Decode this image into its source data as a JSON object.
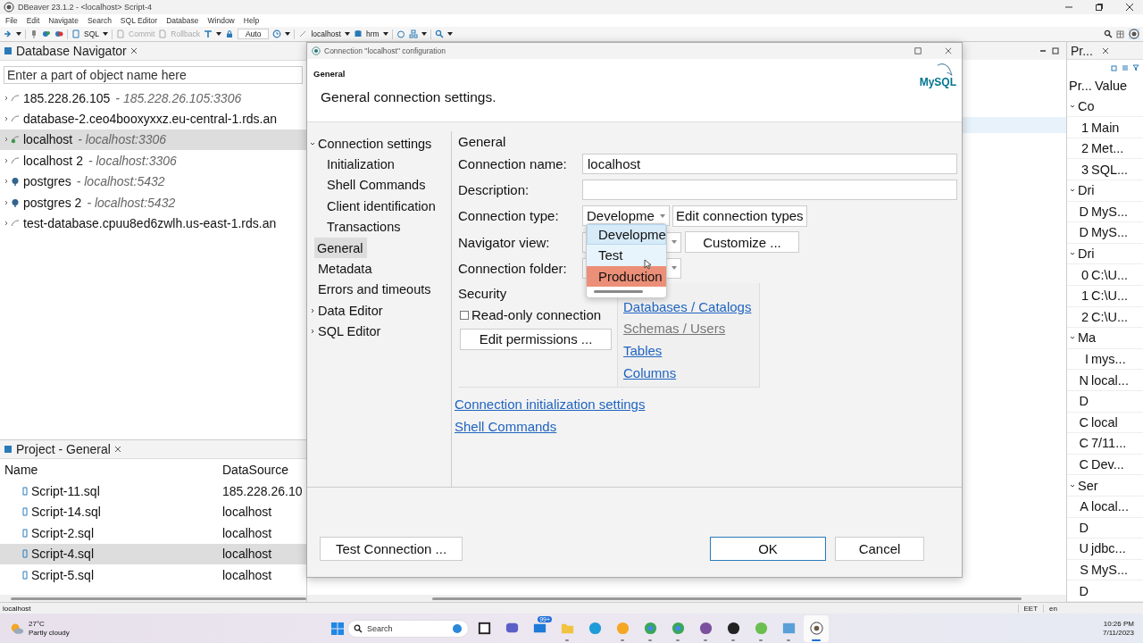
{
  "app_window": {
    "title": "DBeaver 23.1.2 - <localhost> Script-4"
  },
  "menu": [
    "File",
    "Edit",
    "Navigate",
    "Search",
    "SQL Editor",
    "Database",
    "Window",
    "Help"
  ],
  "toolbar": {
    "sql": {
      "label": "SQL"
    },
    "commit": {
      "label": "Commit",
      "disabled": true
    },
    "rollback": {
      "label": "Rollback",
      "disabled": true
    },
    "mode": "Auto",
    "datasource": "localhost",
    "schema": "hrm"
  },
  "navigator": {
    "title": "Database Navigator",
    "search": {
      "placeholder": "Enter a part of object name here"
    },
    "items": [
      {
        "name": "185.228.26.105",
        "detail": "- 185.228.26.105:3306",
        "kind": "mysql",
        "connected": false,
        "selected": false
      },
      {
        "name": "database-2.ceo4booxyxxz.eu-central-1.rds.an",
        "kind": "mysql",
        "connected": false,
        "selected": false
      },
      {
        "name": "localhost",
        "detail": "- localhost:3306",
        "kind": "mysql",
        "connected": true,
        "selected": true
      },
      {
        "name": "localhost 2",
        "detail": "- localhost:3306",
        "kind": "mysql",
        "connected": false,
        "selected": false
      },
      {
        "name": "postgres",
        "detail": "- localhost:5432",
        "kind": "postgres",
        "connected": false,
        "selected": false
      },
      {
        "name": "postgres 2",
        "detail": "- localhost:5432",
        "kind": "postgres",
        "connected": false,
        "selected": false
      },
      {
        "name": "test-database.cpuu8ed6zwlh.us-east-1.rds.an",
        "kind": "mysql",
        "connected": false,
        "selected": false
      }
    ]
  },
  "project": {
    "title": "Project - General",
    "columns": [
      "Name",
      "DataSource"
    ],
    "rows": [
      {
        "name": "Script-11.sql",
        "datasource": "185.228.26.10",
        "selected": false
      },
      {
        "name": "Script-14.sql",
        "datasource": "localhost",
        "selected": false
      },
      {
        "name": "Script-2.sql",
        "datasource": "localhost",
        "selected": false
      },
      {
        "name": "Script-4.sql",
        "datasource": "localhost",
        "selected": true
      },
      {
        "name": "Script-5.sql",
        "datasource": "localhost",
        "selected": false
      }
    ]
  },
  "properties": {
    "title": "Pr...",
    "columns": [
      "Pr...",
      "Value"
    ],
    "rows": [
      {
        "kind": "group",
        "label": "Co",
        "expanded": true
      },
      {
        "kind": "row",
        "key": "1",
        "value": "Main"
      },
      {
        "kind": "row",
        "key": "2",
        "value": "Met..."
      },
      {
        "kind": "row",
        "key": "3",
        "value": "SQL..."
      },
      {
        "kind": "group",
        "label": "Dri",
        "expanded": true
      },
      {
        "kind": "row",
        "key": "D",
        "value": "MyS..."
      },
      {
        "kind": "row",
        "key": "D",
        "value": "MyS..."
      },
      {
        "kind": "group",
        "label": "Dri",
        "expanded": true
      },
      {
        "kind": "row",
        "key": "0",
        "value": "C:\\U..."
      },
      {
        "kind": "row",
        "key": "1",
        "value": "C:\\U..."
      },
      {
        "kind": "row",
        "key": "2",
        "value": "C:\\U..."
      },
      {
        "kind": "group",
        "label": "Ma",
        "expanded": true
      },
      {
        "kind": "row",
        "key": "I",
        "value": "mys..."
      },
      {
        "kind": "row",
        "key": "N",
        "value": "local..."
      },
      {
        "kind": "row",
        "key": "D"
      },
      {
        "kind": "row",
        "key": "C",
        "value": "local"
      },
      {
        "kind": "row",
        "key": "C",
        "value": "7/11..."
      },
      {
        "kind": "row",
        "key": "C",
        "value": "Dev..."
      },
      {
        "kind": "group",
        "label": "Ser",
        "expanded": true
      },
      {
        "kind": "row",
        "key": "A",
        "value": "local..."
      },
      {
        "kind": "row",
        "key": "D"
      },
      {
        "kind": "row",
        "key": "U",
        "value": "jdbc..."
      },
      {
        "kind": "row",
        "key": "S",
        "value": "MyS..."
      },
      {
        "kind": "row",
        "key": "D"
      }
    ]
  },
  "dialog": {
    "title": "Connection \"localhost\" configuration",
    "page_title": "General",
    "description": "General connection settings.",
    "logo": "MySQL",
    "tree": [
      {
        "label": "Connection settings",
        "expanded": true,
        "selected": false,
        "children": [
          {
            "label": "Initialization",
            "selected": false
          },
          {
            "label": "Shell Commands",
            "selected": false
          },
          {
            "label": "Client identification",
            "selected": false
          },
          {
            "label": "Transactions",
            "selected": false
          }
        ]
      },
      {
        "label": "General",
        "selected": true
      },
      {
        "label": "Metadata",
        "selected": false
      },
      {
        "label": "Errors and timeouts",
        "selected": false
      },
      {
        "label": "Data Editor",
        "expanded": false,
        "selected": false
      },
      {
        "label": "SQL Editor",
        "expanded": false,
        "selected": false
      }
    ],
    "section": "General",
    "fields": [
      {
        "label": "Connection name:",
        "kind": "text",
        "value": "localhost"
      },
      {
        "label": "Description:",
        "kind": "text"
      },
      {
        "label": "Connection type:",
        "kind": "combo",
        "value": "Developme",
        "button": "Edit connection types"
      },
      {
        "label": "Navigator view:",
        "kind": "combo",
        "button": "Customize ..."
      },
      {
        "label": "Connection folder:",
        "kind": "combo"
      }
    ],
    "popup": {
      "options": [
        {
          "label": "Developme",
          "color": "#d6eaf8",
          "selected": true
        },
        {
          "label": "Test",
          "color": "#e8f4fc",
          "selected": false
        },
        {
          "label": "Production",
          "color": "#ec8f78",
          "selected": false
        }
      ]
    },
    "security": {
      "title": "Security",
      "readonly": {
        "label": "Read-only connection",
        "checked": false
      },
      "button": "Edit permissions ..."
    },
    "filters": [
      {
        "label": "Databases / Catalogs",
        "disabled": false
      },
      {
        "label": "Schemas / Users",
        "disabled": true
      },
      {
        "label": "Tables",
        "disabled": false
      },
      {
        "label": "Columns",
        "disabled": false
      }
    ],
    "links": [
      "Connection initialization settings",
      "Shell Commands"
    ],
    "buttons": {
      "test": "Test Connection ...",
      "ok": "OK",
      "cancel": "Cancel"
    }
  },
  "status_bar": {
    "left": "localhost",
    "right": [
      "EET",
      "en"
    ]
  },
  "taskbar": {
    "weather": {
      "temp": "27°C",
      "desc": "Partly cloudy"
    },
    "search": {
      "placeholder": "Search"
    },
    "apps": [
      {
        "kind": "taskview",
        "running": false,
        "active": false
      },
      {
        "kind": "chat",
        "running": false,
        "active": false
      },
      {
        "kind": "mail",
        "badge": "99+",
        "running": false,
        "active": false
      },
      {
        "kind": "folder",
        "running": true,
        "active": false
      },
      {
        "kind": "edge",
        "running": false,
        "active": false
      },
      {
        "kind": "orange",
        "running": true,
        "active": false
      },
      {
        "kind": "chrome",
        "running": true,
        "active": false
      },
      {
        "kind": "chrome",
        "running": true,
        "active": false
      },
      {
        "kind": "viber",
        "running": true,
        "active": false
      },
      {
        "kind": "dark",
        "running": true,
        "active": false
      },
      {
        "kind": "green",
        "running": true,
        "active": false
      },
      {
        "kind": "chart",
        "running": true,
        "active": false
      },
      {
        "kind": "beaver",
        "running": true,
        "active": true
      }
    ],
    "time": "10:26 PM",
    "date": "7/11/2023"
  }
}
